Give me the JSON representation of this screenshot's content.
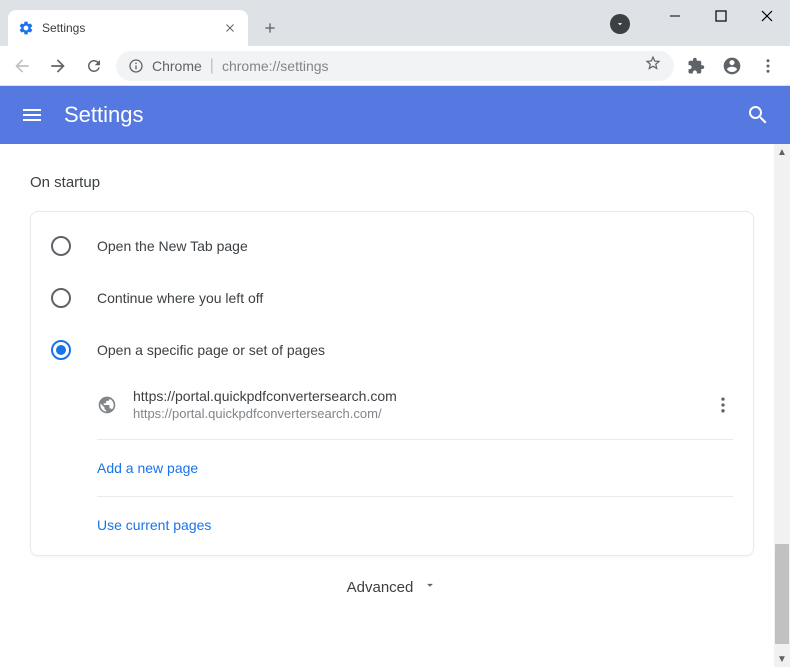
{
  "window": {
    "tab_title": "Settings"
  },
  "omnibox": {
    "scheme_label": "Chrome",
    "url": "chrome://settings"
  },
  "header": {
    "title": "Settings"
  },
  "section": {
    "label": "On startup"
  },
  "startup": {
    "option_new_tab": "Open the New Tab page",
    "option_continue": "Continue where you left off",
    "option_specific": "Open a specific page or set of pages",
    "selected": "specific",
    "pages": [
      {
        "name": "https://portal.quickpdfconvertersearch.com",
        "url": "https://portal.quickpdfconvertersearch.com/"
      }
    ],
    "add_new_page": "Add a new page",
    "use_current": "Use current pages"
  },
  "advanced": {
    "label": "Advanced"
  }
}
